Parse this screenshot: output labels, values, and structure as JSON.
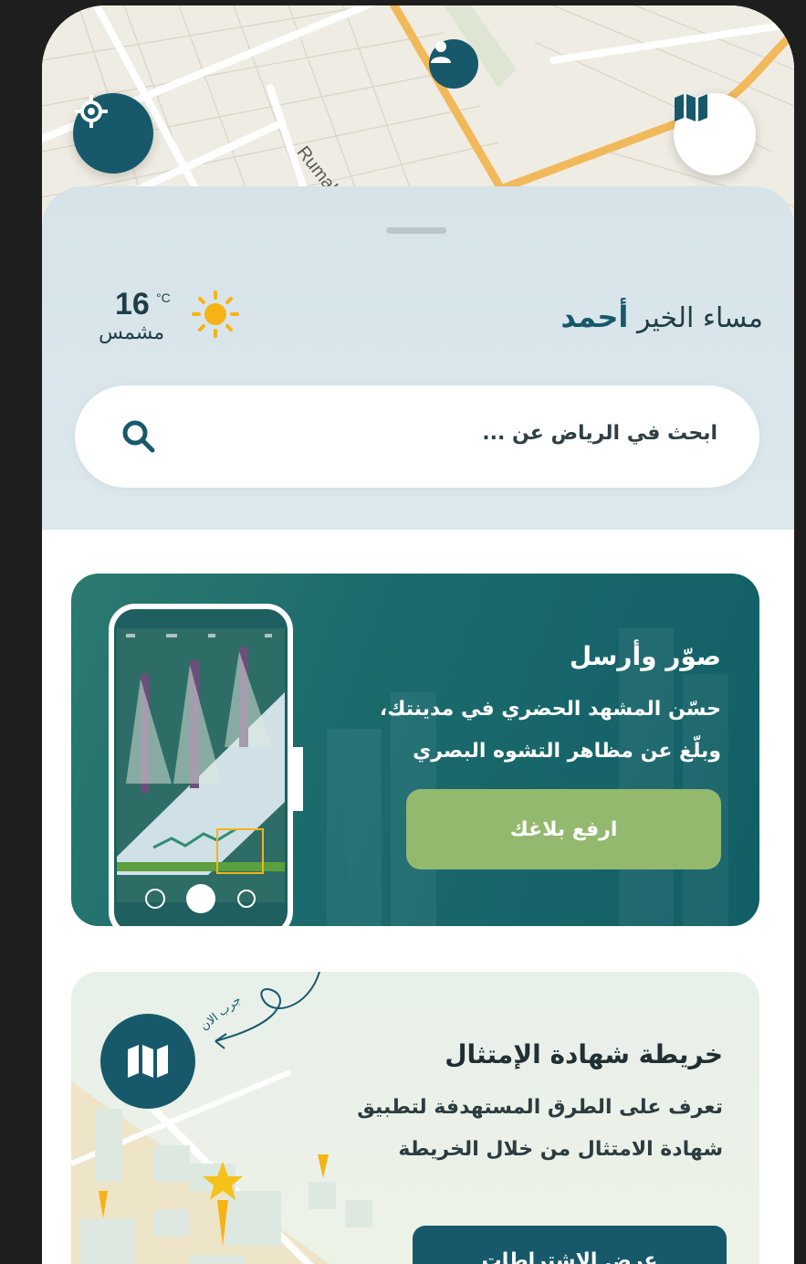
{
  "map": {
    "street_label": "Rumah St"
  },
  "greeting": {
    "prefix": "مساء الخير",
    "name": "أحمد"
  },
  "weather": {
    "temperature": "16",
    "unit": "°C",
    "condition": "مشمس",
    "icon": "sun-icon"
  },
  "search": {
    "placeholder": "ابحث في الرياض عن ..."
  },
  "report_card": {
    "title": "صوّر وأرسل",
    "line1": "حسّن المشهد الحضري في مدينتك،",
    "line2": "وبلّغ عن مظاهر التشوه البصري",
    "button_label": "ارفع بلاغك"
  },
  "compliance_card": {
    "title": "خريطة شهادة الإمتثال",
    "line1": "تعرف على الطرق المستهدفة لتطبيق",
    "line2": "شهادة الامتثال من خلال الخريطة",
    "hint": "جرب الان",
    "button_label": "عرض الاشتراطات"
  },
  "colors": {
    "primary": "#17596b",
    "accent_green": "#93b96f",
    "sun": "#f5b316"
  }
}
